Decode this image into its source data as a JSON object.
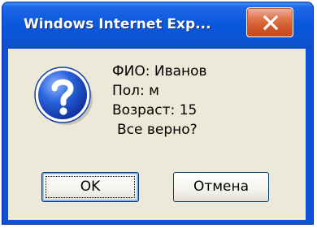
{
  "window": {
    "title": "Windows Internet Exp...",
    "close_label": "X"
  },
  "icon": {
    "name": "question-icon"
  },
  "message": {
    "lines": [
      "ФИО: Иванов",
      "Пол: м",
      "Возраст: 15",
      "Все верно?"
    ]
  },
  "buttons": {
    "ok_label": "OK",
    "cancel_label": "Отмена"
  },
  "colors": {
    "titlebar": "#0b58dc",
    "dialog_background": "#ece9d8",
    "close_button": "#d35a2b",
    "icon_blue": "#1a4fc6"
  }
}
